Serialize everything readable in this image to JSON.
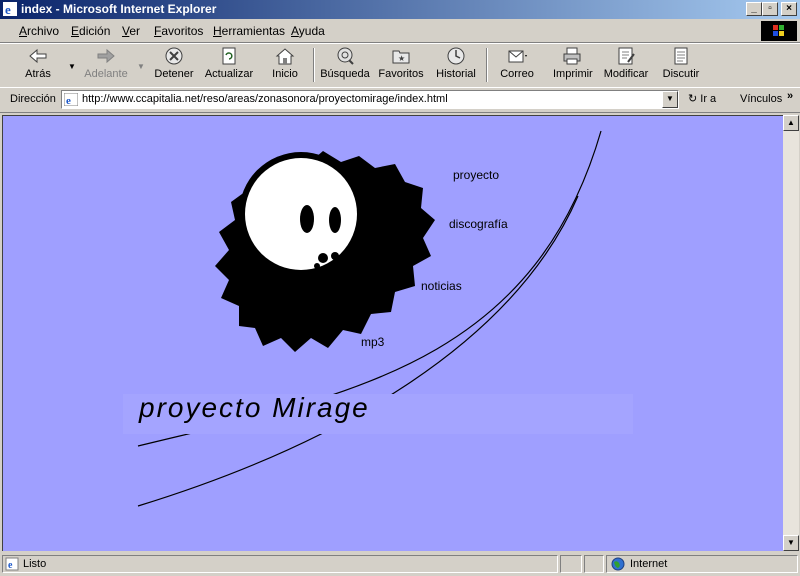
{
  "window": {
    "title": "index - Microsoft Internet Explorer"
  },
  "menu": [
    "Archivo",
    "Edición",
    "Ver",
    "Favoritos",
    "Herramientas",
    "Ayuda"
  ],
  "toolbar": {
    "back": "Atrás",
    "forward": "Adelante",
    "stop": "Detener",
    "refresh": "Actualizar",
    "home": "Inicio",
    "search": "Búsqueda",
    "favorites": "Favoritos",
    "history": "Historial",
    "mail": "Correo",
    "print": "Imprimir",
    "edit": "Modificar",
    "discuss": "Discutir"
  },
  "address": {
    "label": "Dirección",
    "url": "http://www.ccapitalia.net/reso/areas/zonasonora/proyectomirage/index.html",
    "go": "Ir a",
    "links": "Vínculos"
  },
  "page": {
    "nav": {
      "proyecto": "proyecto",
      "discografia": "discografía",
      "noticias": "noticias",
      "mp3": "mp3"
    },
    "logo_text": "proyecto Mirage",
    "background": "#9f9fff"
  },
  "status": {
    "text": "Listo",
    "zone": "Internet"
  }
}
